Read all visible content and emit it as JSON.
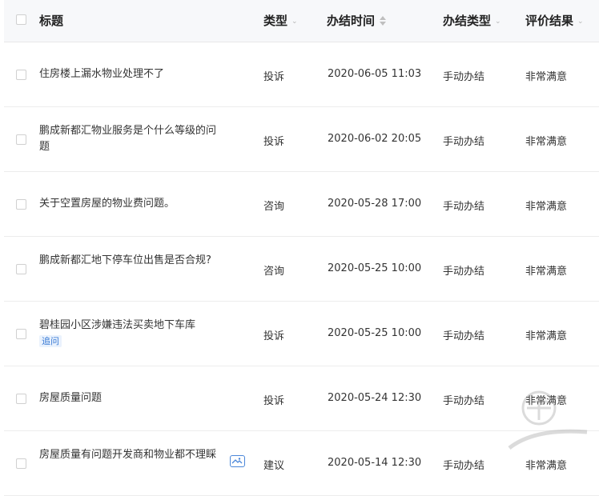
{
  "headers": {
    "title": "标题",
    "type": "类型",
    "time": "办结时间",
    "mode": "办结类型",
    "result": "评价结果"
  },
  "rows": [
    {
      "title": "住房楼上漏水物业处理不了",
      "type": "投诉",
      "time": "2020-06-05 11:03",
      "mode": "手动办结",
      "result": "非常满意",
      "tag": ""
    },
    {
      "title": "鹏成新都汇物业服务是个什么等级的问题",
      "type": "投诉",
      "time": "2020-06-02 20:05",
      "mode": "手动办结",
      "result": "非常满意",
      "tag": ""
    },
    {
      "title": "关于空置房屋的物业费问题。",
      "type": "咨询",
      "time": "2020-05-28 17:00",
      "mode": "手动办结",
      "result": "非常满意",
      "tag": ""
    },
    {
      "title": "鹏成新都汇地下停车位出售是否合规?",
      "type": "咨询",
      "time": "2020-05-25 10:00",
      "mode": "手动办结",
      "result": "非常满意",
      "tag": ""
    },
    {
      "title": "碧桂园小区涉嫌违法买卖地下车库",
      "type": "投诉",
      "time": "2020-05-25 10:00",
      "mode": "手动办结",
      "result": "非常满意",
      "tag": "追问"
    },
    {
      "title": "房屋质量问题",
      "type": "投诉",
      "time": "2020-05-24 12:30",
      "mode": "手动办结",
      "result": "非常满意",
      "tag": ""
    },
    {
      "title": "房屋质量有问题开发商和物业都不理睬",
      "type": "建议",
      "time": "2020-05-14 12:30",
      "mode": "手动办结",
      "result": "非常满意",
      "tag": ""
    }
  ],
  "icons": {
    "sort": "sort-icon",
    "filter": "chevron-down-icon",
    "attachment": "image-icon"
  },
  "colors": {
    "header_bg": "#f7f8fa",
    "tag_text": "#3a7bd5",
    "tag_bg": "#eaf2fd"
  }
}
